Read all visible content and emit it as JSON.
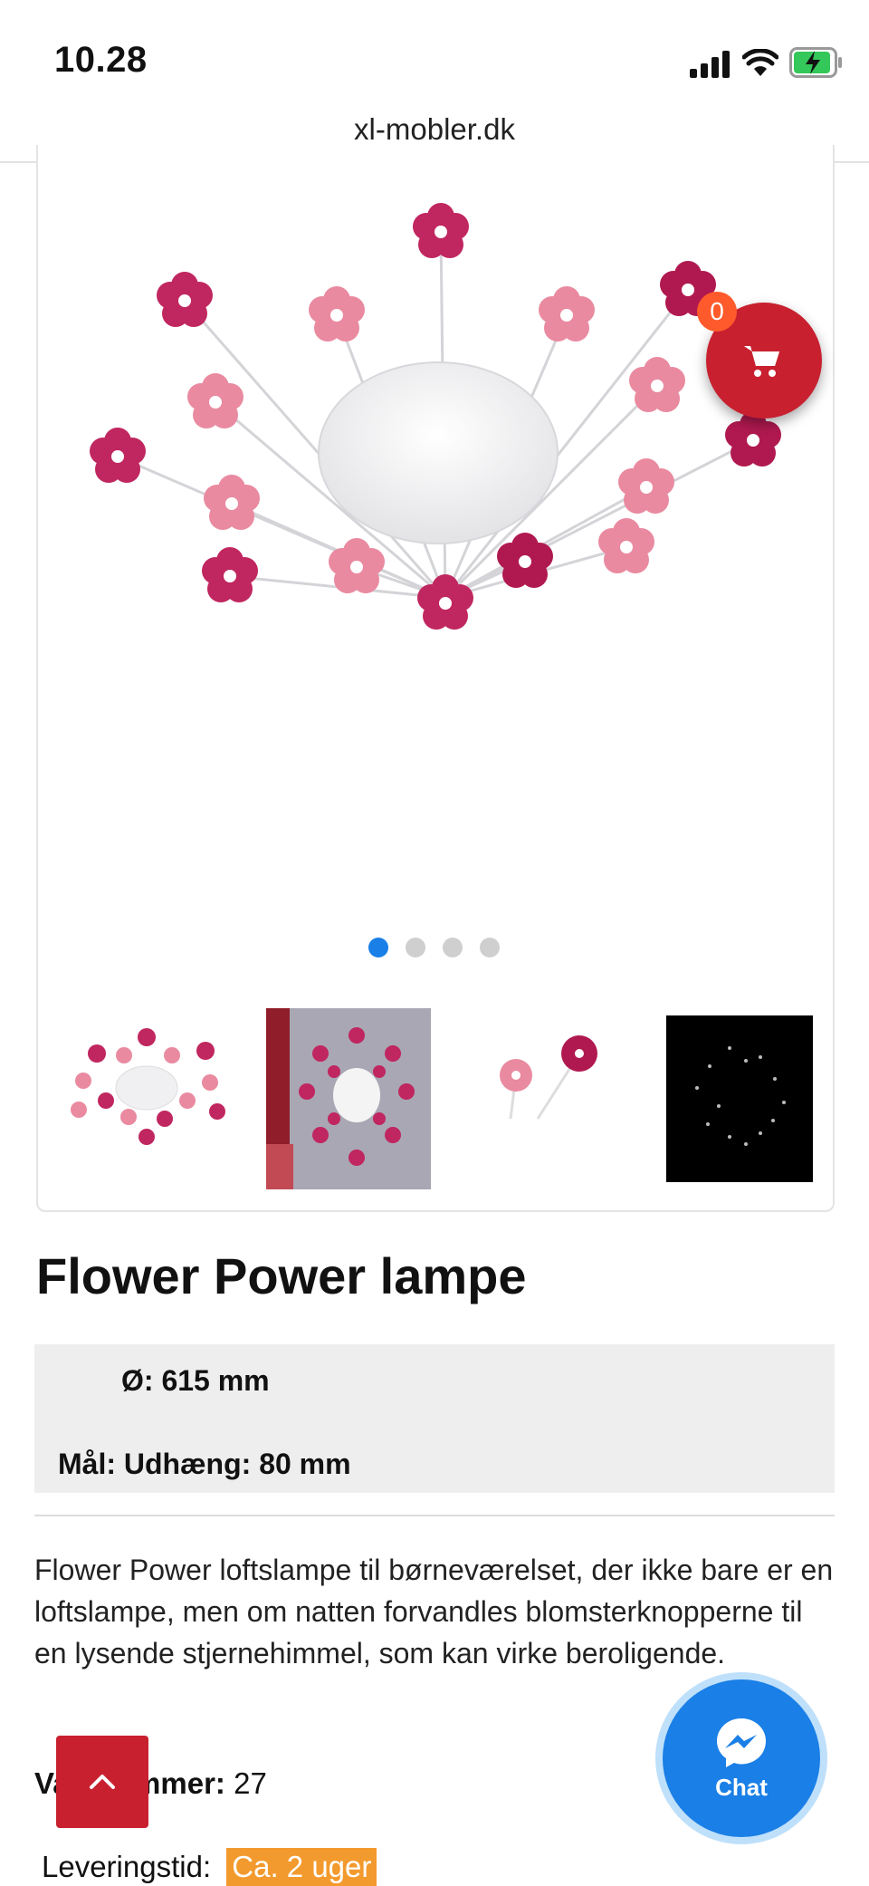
{
  "status_bar": {
    "time": "10.28"
  },
  "browser": {
    "url": "xl-mobler.dk"
  },
  "cart": {
    "count": "0"
  },
  "gallery": {
    "slides": 4,
    "active_slide": 1,
    "thumbnails": [
      "flower-lamp-white",
      "flower-lamp-room",
      "flower-closeup",
      "star-night-glow"
    ]
  },
  "product": {
    "title": "Flower Power lampe",
    "spec_diameter": "Ø: 615 mm",
    "spec_dimensions": "Mål: Udhæng: 80 mm",
    "description": "Flower Power loftslampe til børneværelset, der ikke bare er en loftslampe, men om natten forvandles blomsterknopperne til en lysende stjernehimmel, som kan virke beroligende.",
    "item_number_label": "Varenummer:",
    "item_number_value": "27",
    "delivery_label": "Leveringstid:",
    "delivery_value": "Ca. 2 uger"
  },
  "chat": {
    "label": "Chat"
  },
  "colors": {
    "brand_red": "#c8202f",
    "accent_blue": "#1a7fe6",
    "delivery_orange": "#f39a2e",
    "badge_orange": "#ff5a2b"
  }
}
